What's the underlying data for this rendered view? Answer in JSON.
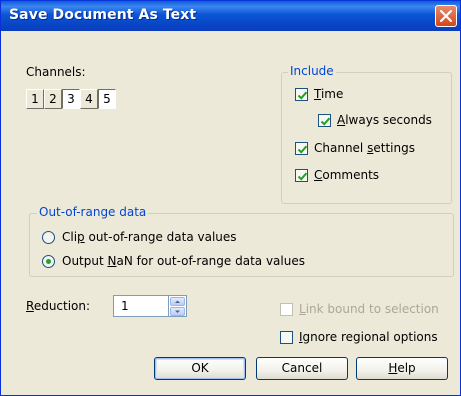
{
  "window": {
    "title": "Save Document As Text"
  },
  "channels": {
    "label": "Channels:",
    "items": [
      {
        "label": "1",
        "selected": false
      },
      {
        "label": "2",
        "selected": false
      },
      {
        "label": "3",
        "selected": true
      },
      {
        "label": "4",
        "selected": false
      },
      {
        "label": "5",
        "selected": true
      }
    ]
  },
  "include": {
    "title": "Include",
    "time": {
      "label": "Time",
      "checked": true
    },
    "always_seconds": {
      "label": "Always seconds",
      "checked": true
    },
    "channel_settings": {
      "label": "Channel settings",
      "checked": true
    },
    "comments": {
      "label": "Comments",
      "checked": true
    }
  },
  "out_of_range": {
    "title": "Out-of-range data",
    "clip": {
      "label": "Clip out-of-range data values",
      "selected": false
    },
    "nan": {
      "label": "Output NaN for out-of-range data values",
      "selected": true
    }
  },
  "reduction": {
    "label": "Reduction:",
    "value": "1"
  },
  "link_bound": {
    "label": "Link bound to selection",
    "checked": false,
    "enabled": false
  },
  "ignore_regional": {
    "label": "Ignore regional options",
    "checked": false
  },
  "buttons": {
    "ok": "OK",
    "cancel": "Cancel",
    "help": "Help"
  },
  "colors": {
    "title_bar": "#0a5ddb",
    "group_title": "#0046d5",
    "check": "#21a121"
  }
}
